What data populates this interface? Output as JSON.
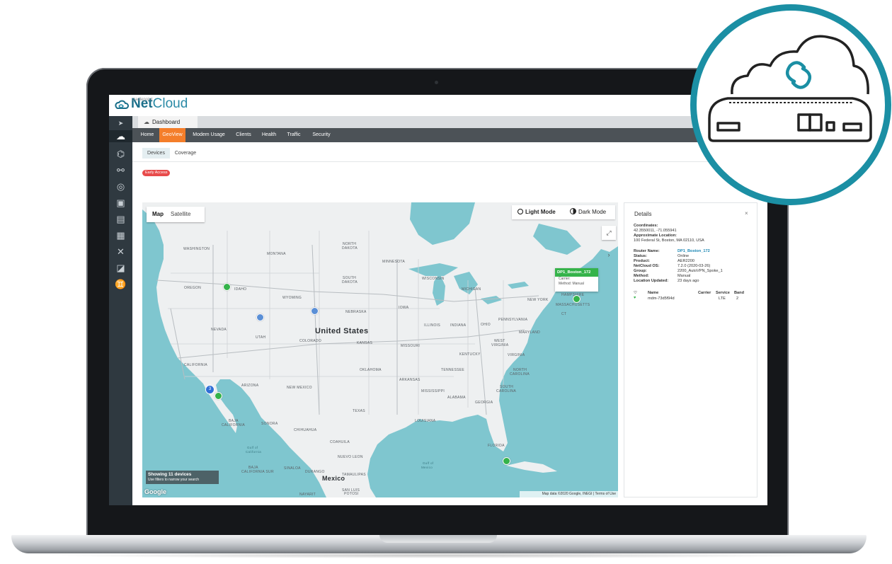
{
  "brand": {
    "small": "cradlepoint",
    "name_bold": "Net",
    "name_light": "Cloud"
  },
  "breadcrumb": {
    "label": "Dashboard"
  },
  "nav": {
    "tabs": [
      "Home",
      "GeoView",
      "Modem Usage",
      "Clients",
      "Health",
      "Traffic",
      "Security"
    ],
    "active": "GeoView"
  },
  "subtabs": {
    "items": [
      "Devices",
      "Coverage"
    ],
    "active": "Devices"
  },
  "early_access": "Early Access",
  "map": {
    "type_options": [
      "Map",
      "Satellite"
    ],
    "selected_type": "Map",
    "mode_light": "Light Mode",
    "mode_dark": "Dark Mode",
    "showing_title": "Showing 11 devices",
    "showing_sub": "Use filters to narrow your search",
    "google": "Google",
    "attribution": "Map data ©2020 Google, INEGI | Terms of Use",
    "cluster_count": "3",
    "popup": {
      "title": "DP1_Boston_172",
      "carrier_label": "Carrier:",
      "method_label": "Method:",
      "method_value": "Manual"
    },
    "labels": {
      "washington": "WASHINGTON",
      "montana": "MONTANA",
      "north_dakota_1": "NORTH",
      "north_dakota_2": "DAKOTA",
      "minnesota": "MINNESOTA",
      "oregon": "OREGON",
      "idaho": "IDAHO",
      "wyoming": "WYOMING",
      "south_dakota_1": "SOUTH",
      "south_dakota_2": "DAKOTA",
      "wisconsin": "WISCONSIN",
      "michigan": "MICHIGAN",
      "new_york": "NEW YORK",
      "iowa": "IOWA",
      "nebraska": "NEBRASKA",
      "nevada": "NEVADA",
      "utah": "UTAH",
      "united_states": "United States",
      "illinois": "ILLINOIS",
      "indiana": "INDIANA",
      "ohio": "OHIO",
      "pennsylvania": "PENNSYLVANIA",
      "colorado": "COLORADO",
      "kansas": "KANSAS",
      "missouri": "MISSOURI",
      "maryland": "MARYLAND",
      "west_virginia_1": "WEST",
      "west_virginia_2": "VIRGINIA",
      "virginia": "VIRGINIA",
      "kentucky": "KENTUCKY",
      "california": "CALIFORNIA",
      "oklahoma": "OKLAHOMA",
      "tennessee": "TENNESSEE",
      "north_carolina_1": "NORTH",
      "north_carolina_2": "CAROLINA",
      "arizona": "ARIZONA",
      "new_mexico": "NEW MEXICO",
      "arkansas": "ARKANSAS",
      "south_carolina_1": "SOUTH",
      "south_carolina_2": "CAROLINA",
      "mississippi": "MISSISSIPPI",
      "alabama": "ALABAMA",
      "georgia": "GEORGIA",
      "texas": "TEXAS",
      "louisiana": "LOUISIANA",
      "baja_1": "BAJA",
      "baja_2": "CALIFORNIA",
      "sonora": "SONORA",
      "chihuahua": "CHIHUAHUA",
      "coahuila": "COAHUILA",
      "nuevo_leon": "NUEVO LEON",
      "florida": "FLORIDA",
      "baja_sur_1": "BAJA",
      "baja_sur_2": "CALIFORNIA SUR",
      "sinaloa": "SINALOA",
      "durango": "DURANGO",
      "tamaulipas": "TAMAULIPAS",
      "mexico": "Mexico",
      "san_luis_1": "SAN LUIS",
      "san_luis_2": "POTOSI",
      "nayarit": "NAYARIT",
      "gulf_1": "Gulf of",
      "gulf_2": "Mexico",
      "gulf_cal_1": "Gulf of",
      "gulf_cal_2": "California",
      "ct": "CT",
      "hampshire": "HAMPSHIRE",
      "massachusetts": "MASSACHUSETTS"
    }
  },
  "details": {
    "title": "Details",
    "close": "×",
    "coordinates_label": "Coordinates:",
    "coordinates_value": "42.3550011, -71.055941",
    "approx_label": "Approximate Location:",
    "approx_value": "100 Federal St, Boston, MA 02110, USA",
    "fields": [
      {
        "key": "Router Name:",
        "value": "DP1_Boston_172"
      },
      {
        "key": "Status:",
        "value": "Online"
      },
      {
        "key": "Product:",
        "value": "AER2200"
      },
      {
        "key": "NetCloud OS:",
        "value": "7.2.0 (2020-03-26)"
      },
      {
        "key": "Group:",
        "value": "2200_AutoVPN_Spoke_1"
      },
      {
        "key": "Method:",
        "value": "Manual"
      },
      {
        "key": "Location Updated:",
        "value": "23 days ago"
      }
    ],
    "modem_table": {
      "headers": [
        "Name",
        "Carrier",
        "Service",
        "Band"
      ],
      "row": {
        "name": "mdm-73d5f94d",
        "carrier": "",
        "service": "LTE",
        "band": "2"
      }
    }
  },
  "colors": {
    "accent_orange": "#f47e2a",
    "brand_teal": "#1b8fa4",
    "nav_dark": "#4c5257",
    "sidebar": "#2f3940",
    "online_green": "#35b34a",
    "water": "#7fc6cf"
  }
}
